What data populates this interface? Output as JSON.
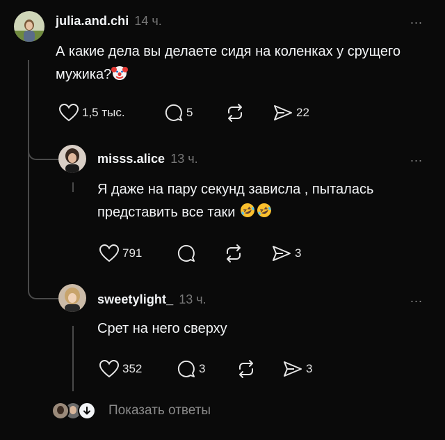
{
  "comments": [
    {
      "username": "julia.and.chi",
      "time": "14 ч.",
      "text": "А какие дела вы делаете сидя на коленках у срущего мужика?",
      "text_emoji": "clown-face",
      "likes": "1,5 тыс.",
      "replies": "5",
      "reposts": "",
      "shares": "22"
    },
    {
      "username": "misss.alice",
      "time": "13 ч.",
      "text": "Я даже на пару секунд зависла , пыталась представить все таки",
      "text_emoji": "rolling-laughing-face x2",
      "likes": "791",
      "replies": "",
      "reposts": "",
      "shares": "3"
    },
    {
      "username": "sweetylight_",
      "time": "13 ч.",
      "text": "Срет на него сверху",
      "likes": "352",
      "replies": "3",
      "reposts": "",
      "shares": "3"
    }
  ],
  "footer": {
    "show_replies_label": "Показать ответы"
  },
  "more_label": "...",
  "colors": {
    "background": "#0a0a0a",
    "text": "#f3f5f7",
    "muted": "#777777",
    "thread_line": "#4a4a4a"
  }
}
